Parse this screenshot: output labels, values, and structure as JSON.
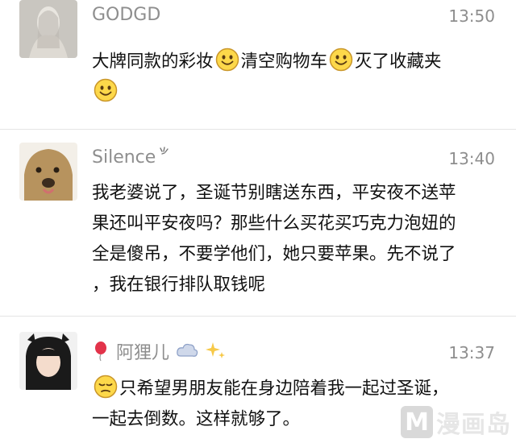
{
  "comments": [
    {
      "name": "GODGD",
      "time": "13:50",
      "lines": [
        "大牌同款的彩妆",
        "清空购物车",
        "灭了收藏夹"
      ]
    },
    {
      "name": "Silence",
      "time": "13:40",
      "lines": [
        "我老婆说了，圣诞节别瞎送东西，平安夜不送苹",
        "果还叫平安夜吗？那些什么买花买巧克力泡妞的",
        "全是傻吊，不要学他们，她只要苹果。先不说了",
        "，我在银行排队取钱呢"
      ]
    },
    {
      "name": "阿狸儿",
      "time": "13:37",
      "lines": [
        "只希望男朋友能在身边陪着我一起过圣诞，",
        "一起去倒数。这样就够了。"
      ]
    }
  ],
  "watermark": {
    "letter": "M",
    "text": "漫画岛"
  },
  "icons": {
    "smile": "smile-emoji-icon",
    "sad": "pensive-emoji-icon",
    "balloon": "balloon-icon",
    "cloud": "cloud-icon",
    "sparkle": "sparkles-icon",
    "signal": "sparkle-mark-icon"
  }
}
